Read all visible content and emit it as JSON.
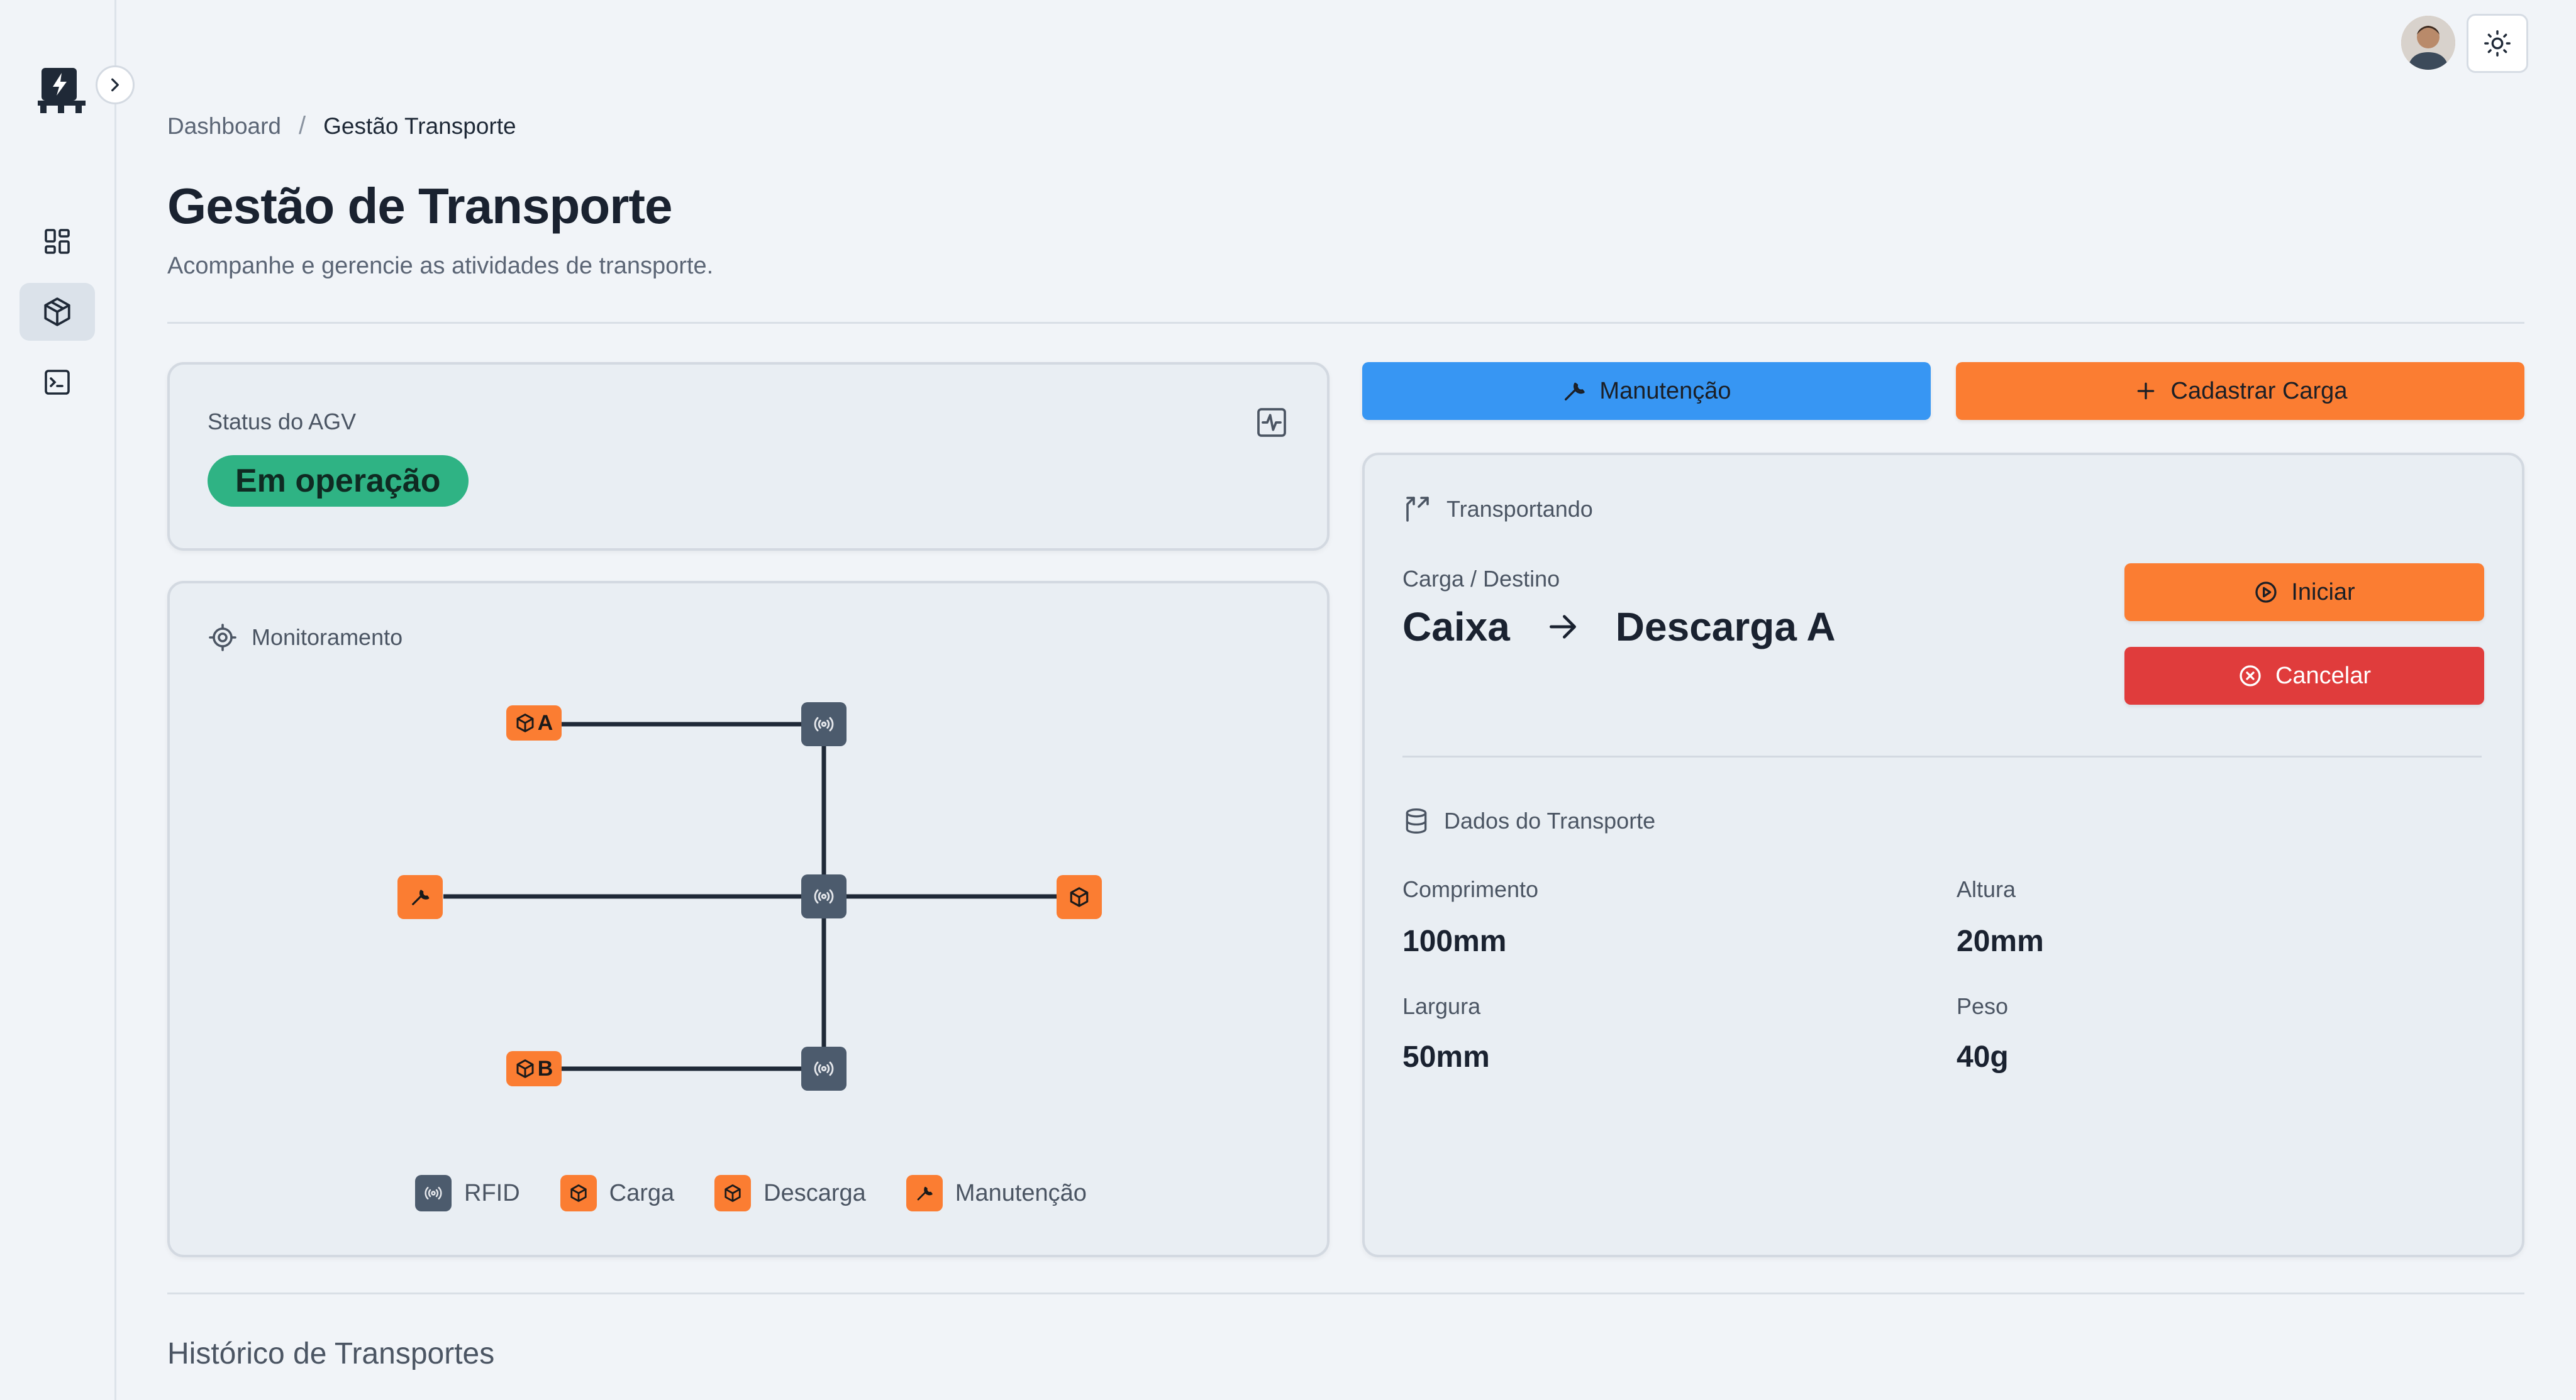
{
  "breadcrumb": {
    "home": "Dashboard",
    "separator": "/",
    "current": "Gestão Transporte"
  },
  "page": {
    "title": "Gestão de Transporte",
    "subtitle": "Acompanhe e gerencie as atividades de transporte."
  },
  "status": {
    "label": "Status do AGV",
    "value": "Em operação",
    "badge_color": "#2fb384"
  },
  "monitor": {
    "title": "Monitoramento",
    "nodes": {
      "load_a": "A",
      "load_b": "B"
    },
    "legend": [
      "RFID",
      "Carga",
      "Descarga",
      "Manutenção"
    ]
  },
  "actions": {
    "maintenance": "Manutenção",
    "register_load": "Cadastrar Carga"
  },
  "transport": {
    "title": "Transportando",
    "cargo_destination_label": "Carga / Destino",
    "cargo": "Caixa",
    "destination": "Descarga A",
    "start": "Iniciar",
    "cancel": "Cancelar",
    "data_title": "Dados do Transporte",
    "fields": [
      {
        "label": "Comprimento",
        "value": "100mm"
      },
      {
        "label": "Altura",
        "value": "20mm"
      },
      {
        "label": "Largura",
        "value": "50mm"
      },
      {
        "label": "Peso",
        "value": "40g"
      }
    ]
  },
  "history": {
    "title": "Histórico de Transportes"
  },
  "colors": {
    "orange": "#fb7d32",
    "blue": "#3796f3",
    "red": "#e03c3c",
    "slate": "#4c5b6d"
  },
  "icons": {
    "nav": [
      "dashboard-icon",
      "package-icon",
      "terminal-icon"
    ],
    "theme": "sun-icon"
  }
}
